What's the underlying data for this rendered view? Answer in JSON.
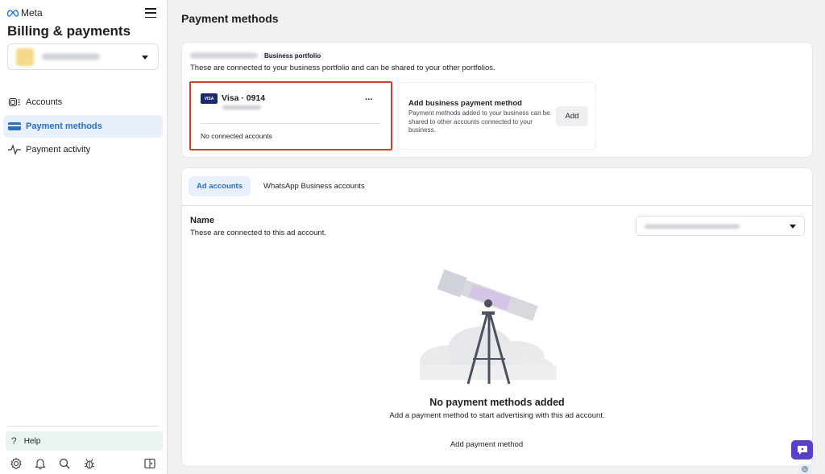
{
  "sidebar": {
    "brand": "Meta",
    "title": "Billing & payments",
    "account_selector": {
      "value": "[blurred business name]"
    },
    "nav": [
      {
        "label": "Accounts",
        "icon": "accounts-icon",
        "active": false
      },
      {
        "label": "Payment methods",
        "icon": "credit-card-icon",
        "active": true
      },
      {
        "label": "Payment activity",
        "icon": "activity-pulse-icon",
        "active": false
      }
    ],
    "help": {
      "icon": "?",
      "label": "Help"
    },
    "footer_icons": [
      "settings-icon",
      "bell-icon",
      "search-icon",
      "bug-icon",
      "panel-toggle-icon"
    ]
  },
  "main": {
    "page_title": "Payment methods",
    "portfolio_card": {
      "portfolio_name": "[blurred]",
      "badge": "Business portfolio",
      "description": "These are connected to your business portfolio and can be shared to your other portfolios.",
      "payment_method": {
        "brand_logo": "VISA",
        "label": "Visa · 0914",
        "expiry": "[blurred]",
        "more_label": "···",
        "status": "No connected accounts",
        "highlight_color": "#c7442f"
      },
      "add_business_method": {
        "title": "Add business payment method",
        "description": "Payment methods added to your business can be shared to other accounts connected to your business.",
        "button_label": "Add"
      }
    },
    "accounts_card": {
      "tabs": [
        {
          "label": "Ad accounts",
          "active": true
        },
        {
          "label": "WhatsApp Business accounts",
          "active": false
        }
      ],
      "name_heading": "Name",
      "name_description": "These are connected to this ad account.",
      "ad_account_dropdown": {
        "value": "[blurred ad account name]"
      },
      "empty_state": {
        "illustration": "telescope-illustration",
        "title": "No payment methods added",
        "description": "Add a payment method to start advertising with this ad account.",
        "action_label": "Add payment method"
      }
    }
  },
  "floating": {
    "chat_button": "chat-support-icon",
    "globe_button": "globe-icon"
  },
  "colors": {
    "accent": "#2b6fbd",
    "active_bg": "#e7f0fb",
    "chat": "#5b3fc9",
    "highlight": "#c7442f"
  }
}
